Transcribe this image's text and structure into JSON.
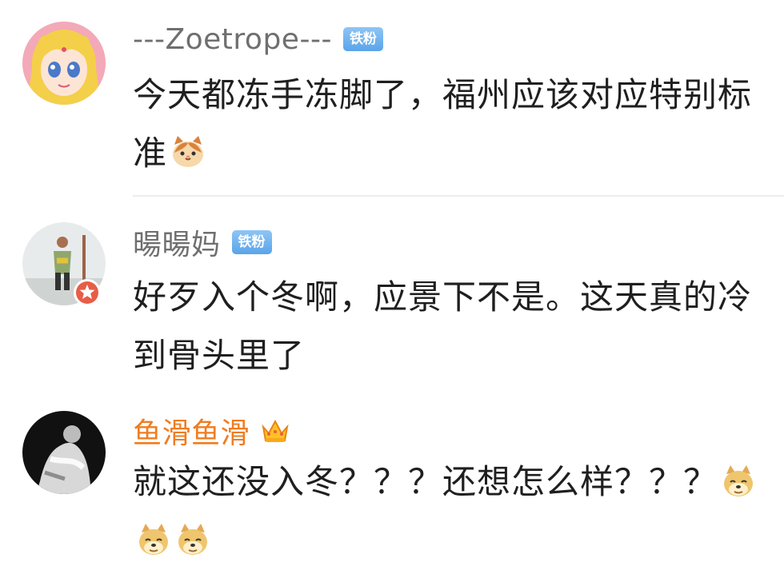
{
  "comments": [
    {
      "username": "---Zoetrope---",
      "badge": "铁粉",
      "text": "今天都冻手冻脚了，福州应该对应特别标准",
      "emojis": [
        "cat-face-emoji"
      ]
    },
    {
      "username": "暘暘妈",
      "badge": "铁粉",
      "text": "好歹入个冬啊，应景下不是。这天真的冷到骨头里了",
      "emojis": []
    },
    {
      "username": "鱼滑鱼滑",
      "badge_icon": "crown-icon",
      "text": "就这还没入冬？？？还想怎么样？？？",
      "emojis": [
        "doge-emoji",
        "doge-emoji",
        "doge-emoji"
      ]
    }
  ],
  "colors": {
    "username": "#6f6f6f",
    "vip_username": "#ef7d22",
    "fan_badge": "#5aa4ea",
    "text": "#1f1f1f"
  }
}
